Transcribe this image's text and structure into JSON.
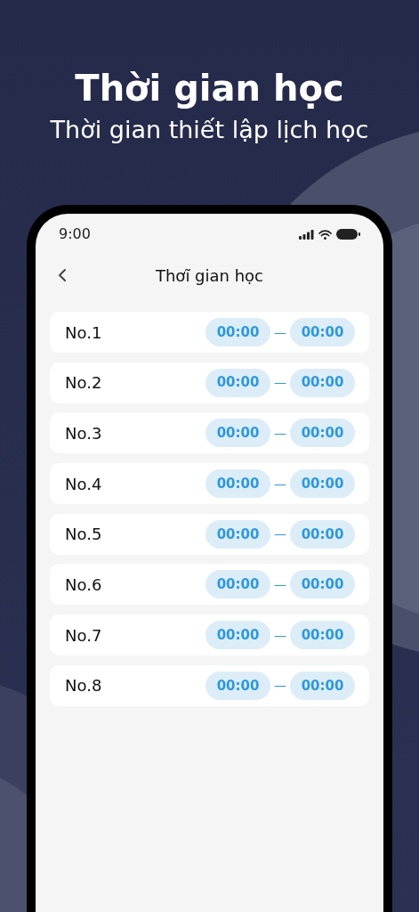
{
  "headline": "Thời gian học",
  "subheadline": "Thời gian thiết lập lịch học",
  "status_bar": {
    "time": "9:00"
  },
  "nav": {
    "title": "Thơĩ gian học"
  },
  "rows": [
    {
      "label": "No.1",
      "start": "00:00",
      "separator": "—",
      "end": "00:00"
    },
    {
      "label": "No.2",
      "start": "00:00",
      "separator": "—",
      "end": "00:00"
    },
    {
      "label": "No.3",
      "start": "00:00",
      "separator": "—",
      "end": "00:00"
    },
    {
      "label": "No.4",
      "start": "00:00",
      "separator": "—",
      "end": "00:00"
    },
    {
      "label": "No.5",
      "start": "00:00",
      "separator": "—",
      "end": "00:00"
    },
    {
      "label": "No.6",
      "start": "00:00",
      "separator": "—",
      "end": "00:00"
    },
    {
      "label": "No.7",
      "start": "00:00",
      "separator": "—",
      "end": "00:00"
    },
    {
      "label": "No.8",
      "start": "00:00",
      "separator": "—",
      "end": "00:00"
    }
  ]
}
